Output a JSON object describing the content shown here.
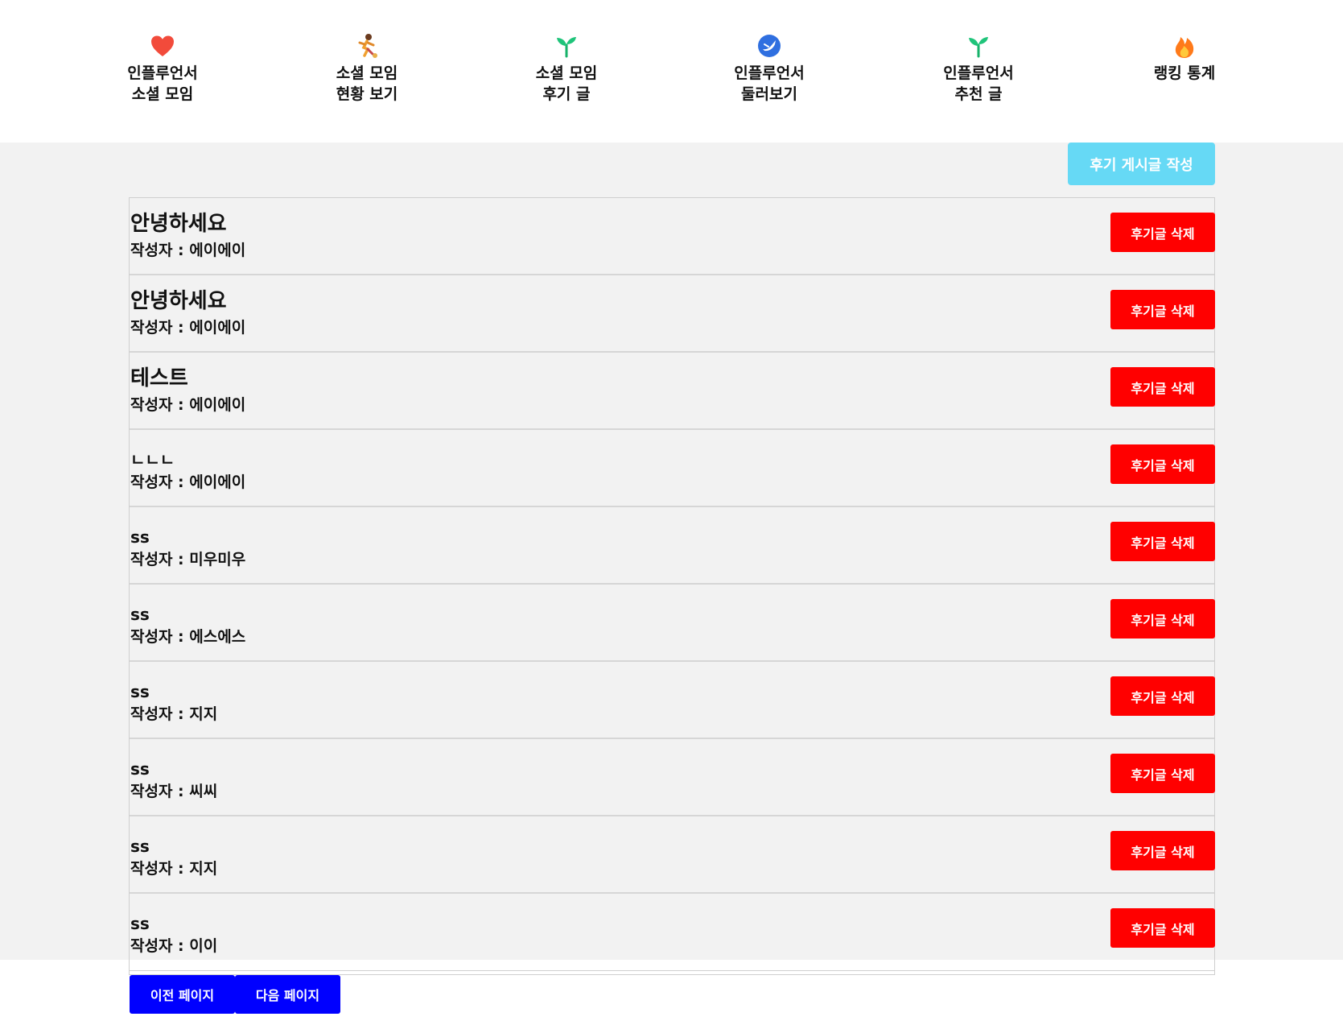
{
  "nav": {
    "items": [
      {
        "label": "인플루언서\n소셜 모임",
        "icon": "heart-icon"
      },
      {
        "label": "소셜 모임\n현황 보기",
        "icon": "person-running-icon"
      },
      {
        "label": "소셜 모임\n후기 글",
        "icon": "sprout-icon"
      },
      {
        "label": "인플루언서\n둘러보기",
        "icon": "bird-badge-icon"
      },
      {
        "label": "인플루언서\n추천 글",
        "icon": "sprout-icon"
      },
      {
        "label": "랭킹 통계",
        "icon": "fire-icon"
      }
    ]
  },
  "toolbar": {
    "write_label": "후기 게시글 작성"
  },
  "reviews": [
    {
      "title": "안녕하세요",
      "author": "작성자 : 에이에이",
      "delete_label": "후기글 삭제"
    },
    {
      "title": "안녕하세요",
      "author": "작성자 : 에이에이",
      "delete_label": "후기글 삭제"
    },
    {
      "title": "테스트",
      "author": "작성자 : 에이에이",
      "delete_label": "후기글 삭제"
    },
    {
      "title": "ㄴㄴㄴ",
      "author": "작성자 : 에이에이",
      "delete_label": "후기글 삭제"
    },
    {
      "title": "ss",
      "author": "작성자 : 미우미우",
      "delete_label": "후기글 삭제"
    },
    {
      "title": "ss",
      "author": "작성자 : 에스에스",
      "delete_label": "후기글 삭제"
    },
    {
      "title": "ss",
      "author": "작성자 : 지지",
      "delete_label": "후기글 삭제"
    },
    {
      "title": "ss",
      "author": "작성자 : 씨씨",
      "delete_label": "후기글 삭제"
    },
    {
      "title": "ss",
      "author": "작성자 : 지지",
      "delete_label": "후기글 삭제"
    },
    {
      "title": "ss",
      "author": "작성자 : 이이",
      "delete_label": "후기글 삭제"
    }
  ],
  "pagination": {
    "prev_label": "이전 페이지",
    "next_label": "다음 페이지"
  },
  "colors": {
    "write_button": "#66d9f5",
    "delete_button": "#ff0000",
    "page_button": "#0000ff",
    "band_background": "#f2f2f2"
  }
}
